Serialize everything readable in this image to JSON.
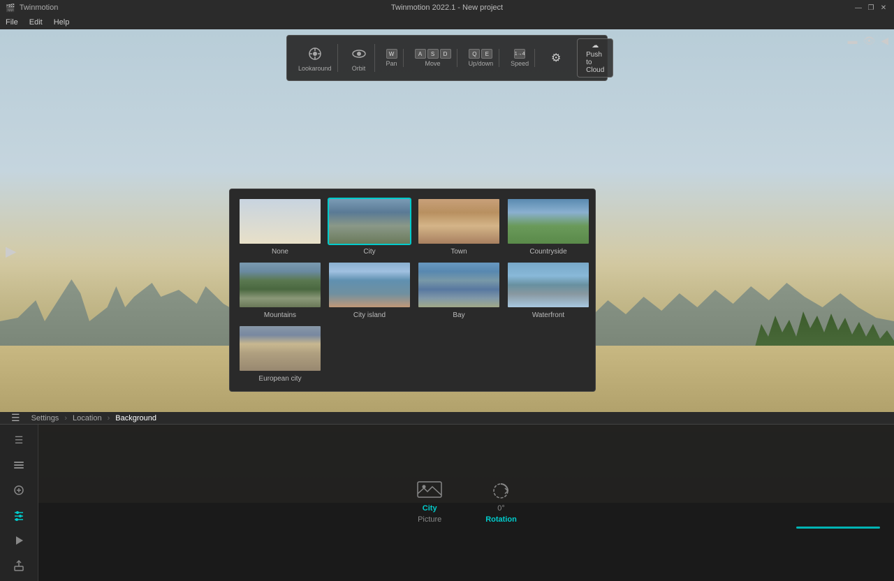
{
  "app": {
    "name": "Twinmotion",
    "window_title": "Twinmotion 2022.1 - New project"
  },
  "titlebar": {
    "menu": [
      "File",
      "Edit",
      "Help"
    ],
    "controls": [
      "—",
      "❐",
      "✕"
    ]
  },
  "toolbar": {
    "lookaround_label": "Lookaround",
    "orbit_label": "Orbit",
    "pan_label": "Pan",
    "move_label": "Move",
    "updown_label": "Up/down",
    "speed_label": "Speed",
    "push_to_cloud": "Push to Cloud"
  },
  "viewport": {
    "scene": "city skyline with sandy ground"
  },
  "breadcrumb": {
    "settings": "Settings",
    "location": "Location",
    "background": "Background",
    "sep": "›"
  },
  "sidebar_icons": [
    {
      "name": "menu-icon",
      "symbol": "☰",
      "active": false
    },
    {
      "name": "layers-icon",
      "symbol": "⊞",
      "active": false
    },
    {
      "name": "adjustments-icon",
      "symbol": "⊜",
      "active": false
    },
    {
      "name": "sliders-icon",
      "symbol": "⊟",
      "active": true
    },
    {
      "name": "media-icon",
      "symbol": "▶",
      "active": false
    },
    {
      "name": "export-icon",
      "symbol": "⊠",
      "active": false
    }
  ],
  "bg_grid": {
    "items": [
      {
        "id": "none",
        "label": "None",
        "thumb_class": "thumb-none",
        "selected": false
      },
      {
        "id": "city",
        "label": "City",
        "thumb_class": "thumb-city",
        "selected": true
      },
      {
        "id": "town",
        "label": "Town",
        "thumb_class": "thumb-town",
        "selected": false
      },
      {
        "id": "countryside",
        "label": "Countryside",
        "thumb_class": "thumb-countryside",
        "selected": false
      },
      {
        "id": "mountains",
        "label": "Mountains",
        "thumb_class": "thumb-mountains",
        "selected": false
      },
      {
        "id": "city-island",
        "label": "City island",
        "thumb_class": "thumb-city-island",
        "selected": false
      },
      {
        "id": "bay",
        "label": "Bay",
        "thumb_class": "thumb-bay",
        "selected": false
      },
      {
        "id": "waterfront",
        "label": "Waterfront",
        "thumb_class": "thumb-waterfront",
        "selected": false
      },
      {
        "id": "european-city",
        "label": "European city",
        "thumb_class": "thumb-european-city",
        "selected": false
      }
    ]
  },
  "controls": {
    "picture": {
      "label": "Picture",
      "value": "City",
      "active": false
    },
    "rotation": {
      "label": "Rotation",
      "value": "0°",
      "active": true
    }
  }
}
